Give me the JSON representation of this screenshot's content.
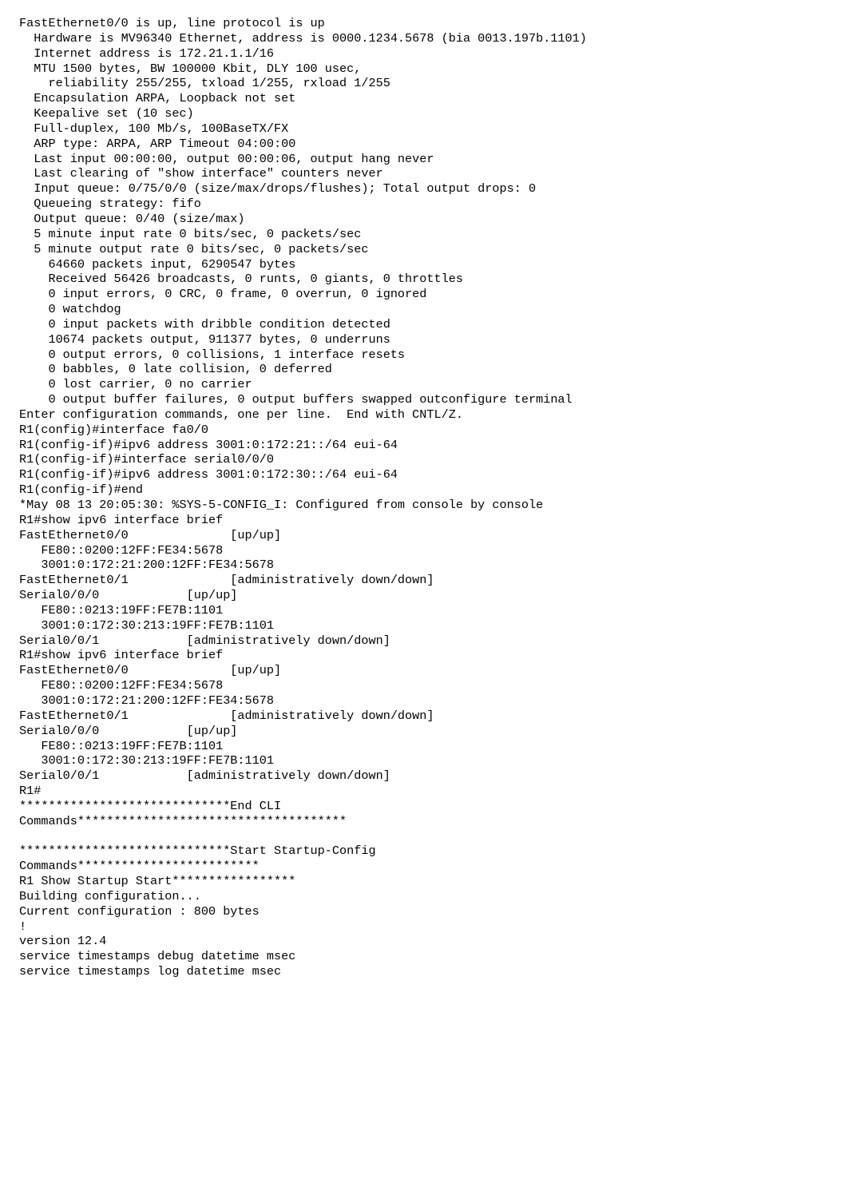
{
  "lines": [
    "FastEthernet0/0 is up, line protocol is up",
    "  Hardware is MV96340 Ethernet, address is 0000.1234.5678 (bia 0013.197b.1101)",
    "  Internet address is 172.21.1.1/16",
    "  MTU 1500 bytes, BW 100000 Kbit, DLY 100 usec,",
    "    reliability 255/255, txload 1/255, rxload 1/255",
    "  Encapsulation ARPA, Loopback not set",
    "  Keepalive set (10 sec)",
    "  Full-duplex, 100 Mb/s, 100BaseTX/FX",
    "  ARP type: ARPA, ARP Timeout 04:00:00",
    "  Last input 00:00:00, output 00:00:06, output hang never",
    "  Last clearing of \"show interface\" counters never",
    "  Input queue: 0/75/0/0 (size/max/drops/flushes); Total output drops: 0",
    "  Queueing strategy: fifo",
    "  Output queue: 0/40 (size/max)",
    "  5 minute input rate 0 bits/sec, 0 packets/sec",
    "  5 minute output rate 0 bits/sec, 0 packets/sec",
    "    64660 packets input, 6290547 bytes",
    "    Received 56426 broadcasts, 0 runts, 0 giants, 0 throttles",
    "    0 input errors, 0 CRC, 0 frame, 0 overrun, 0 ignored",
    "    0 watchdog",
    "    0 input packets with dribble condition detected",
    "    10674 packets output, 911377 bytes, 0 underruns",
    "    0 output errors, 0 collisions, 1 interface resets",
    "    0 babbles, 0 late collision, 0 deferred",
    "    0 lost carrier, 0 no carrier",
    "    0 output buffer failures, 0 output buffers swapped outconfigure terminal",
    "Enter configuration commands, one per line.  End with CNTL/Z.",
    "R1(config)#interface fa0/0",
    "R1(config-if)#ipv6 address 3001:0:172:21::/64 eui-64",
    "R1(config-if)#interface serial0/0/0",
    "R1(config-if)#ipv6 address 3001:0:172:30::/64 eui-64",
    "R1(config-if)#end",
    "*May 08 13 20:05:30: %SYS-5-CONFIG_I: Configured from console by console",
    "R1#show ipv6 interface brief",
    "FastEthernet0/0              [up/up]",
    "   FE80::0200:12FF:FE34:5678",
    "   3001:0:172:21:200:12FF:FE34:5678",
    "FastEthernet0/1              [administratively down/down]",
    "Serial0/0/0            [up/up]",
    "   FE80::0213:19FF:FE7B:1101",
    "   3001:0:172:30:213:19FF:FE7B:1101",
    "Serial0/0/1            [administratively down/down]",
    "R1#show ipv6 interface brief",
    "FastEthernet0/0              [up/up]",
    "   FE80::0200:12FF:FE34:5678",
    "   3001:0:172:21:200:12FF:FE34:5678",
    "FastEthernet0/1              [administratively down/down]",
    "Serial0/0/0            [up/up]",
    "   FE80::0213:19FF:FE7B:1101",
    "   3001:0:172:30:213:19FF:FE7B:1101",
    "Serial0/0/1            [administratively down/down]",
    "R1#",
    "*****************************End CLI",
    "Commands*************************************",
    "",
    "*****************************Start Startup-Config",
    "Commands*************************",
    "R1 Show Startup Start*****************",
    "Building configuration...",
    "Current configuration : 800 bytes",
    "!",
    "version 12.4",
    "service timestamps debug datetime msec",
    "service timestamps log datetime msec"
  ]
}
